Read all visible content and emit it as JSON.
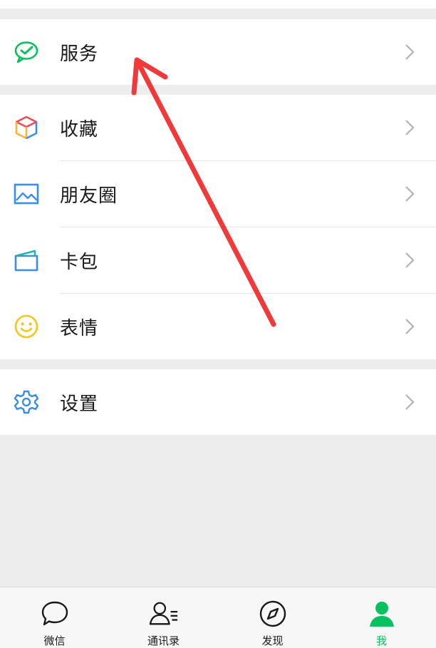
{
  "menu": {
    "service": {
      "label": "服务",
      "icon": "wechat-pay-icon"
    },
    "favorites": {
      "label": "收藏",
      "icon": "cube-icon"
    },
    "moments": {
      "label": "朋友圈",
      "icon": "image-icon"
    },
    "cards": {
      "label": "卡包",
      "icon": "wallet-icon"
    },
    "stickers": {
      "label": "表情",
      "icon": "smiley-icon"
    },
    "settings": {
      "label": "设置",
      "icon": "gear-icon"
    }
  },
  "tabbar": {
    "chats": {
      "label": "微信",
      "icon": "chat-bubble-icon"
    },
    "contacts": {
      "label": "通讯录",
      "icon": "contacts-icon"
    },
    "discover": {
      "label": "发现",
      "icon": "compass-icon"
    },
    "me": {
      "label": "我",
      "icon": "person-icon",
      "active": true
    }
  },
  "colors": {
    "accent_green": "#07c160",
    "annotation_red": "#f03a3a",
    "background": "#ededed"
  }
}
